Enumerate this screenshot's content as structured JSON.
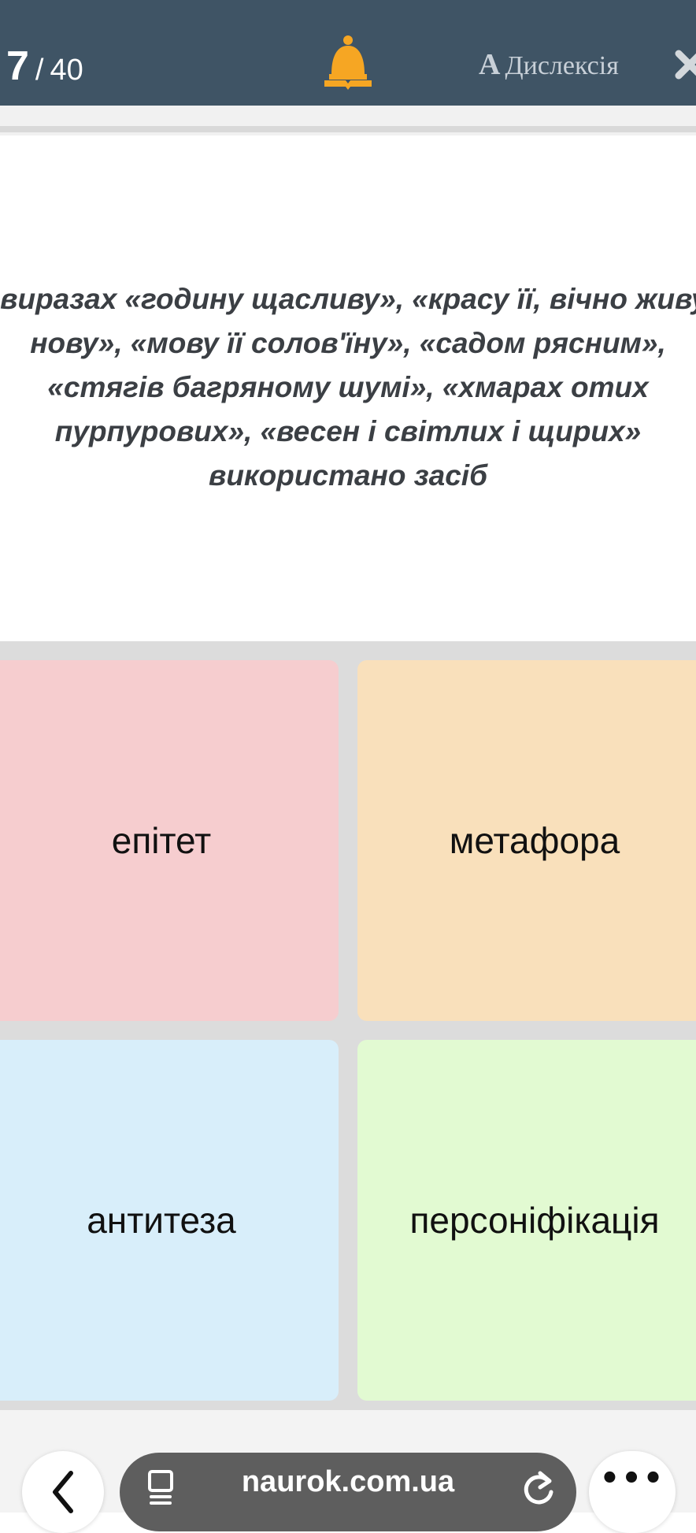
{
  "header": {
    "current_question": "7",
    "separator": "/",
    "total_questions": "40",
    "dyslexia_letter": "A",
    "dyslexia_label": "Дислексія"
  },
  "question": {
    "text": "У виразах «годину щасливу», «красу її, вічно живу і нову», «мову її солов'їну», «садом рясним», «стягів багряному шумі», «хмарах отих пурпурових», «весен і світлих і щирих» використано засіб"
  },
  "answers": [
    {
      "label": "епітет",
      "color": "#f6cdcf"
    },
    {
      "label": "метафора",
      "color": "#f9e0bb"
    },
    {
      "label": "антитеза",
      "color": "#d8eefa"
    },
    {
      "label": "персоніфікація",
      "color": "#e2fad2"
    }
  ],
  "browser": {
    "url": "naurok.com.ua",
    "more_label": "•••"
  },
  "colors": {
    "header_bg": "#3f5465",
    "bell": "#f6a623"
  }
}
